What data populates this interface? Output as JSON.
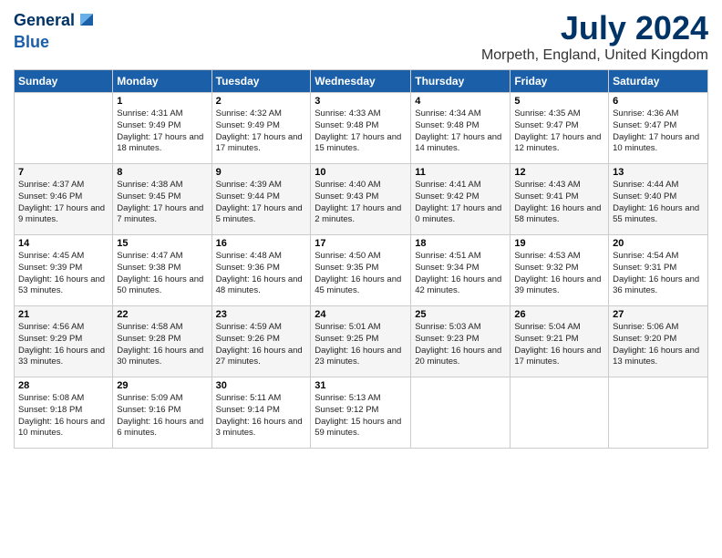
{
  "header": {
    "logo_line1": "General",
    "logo_line2": "Blue",
    "title": "July 2024",
    "subtitle": "Morpeth, England, United Kingdom"
  },
  "columns": [
    "Sunday",
    "Monday",
    "Tuesday",
    "Wednesday",
    "Thursday",
    "Friday",
    "Saturday"
  ],
  "weeks": [
    [
      {
        "date": "",
        "sunrise": "",
        "sunset": "",
        "daylight": ""
      },
      {
        "date": "1",
        "sunrise": "Sunrise: 4:31 AM",
        "sunset": "Sunset: 9:49 PM",
        "daylight": "Daylight: 17 hours and 18 minutes."
      },
      {
        "date": "2",
        "sunrise": "Sunrise: 4:32 AM",
        "sunset": "Sunset: 9:49 PM",
        "daylight": "Daylight: 17 hours and 17 minutes."
      },
      {
        "date": "3",
        "sunrise": "Sunrise: 4:33 AM",
        "sunset": "Sunset: 9:48 PM",
        "daylight": "Daylight: 17 hours and 15 minutes."
      },
      {
        "date": "4",
        "sunrise": "Sunrise: 4:34 AM",
        "sunset": "Sunset: 9:48 PM",
        "daylight": "Daylight: 17 hours and 14 minutes."
      },
      {
        "date": "5",
        "sunrise": "Sunrise: 4:35 AM",
        "sunset": "Sunset: 9:47 PM",
        "daylight": "Daylight: 17 hours and 12 minutes."
      },
      {
        "date": "6",
        "sunrise": "Sunrise: 4:36 AM",
        "sunset": "Sunset: 9:47 PM",
        "daylight": "Daylight: 17 hours and 10 minutes."
      }
    ],
    [
      {
        "date": "7",
        "sunrise": "Sunrise: 4:37 AM",
        "sunset": "Sunset: 9:46 PM",
        "daylight": "Daylight: 17 hours and 9 minutes."
      },
      {
        "date": "8",
        "sunrise": "Sunrise: 4:38 AM",
        "sunset": "Sunset: 9:45 PM",
        "daylight": "Daylight: 17 hours and 7 minutes."
      },
      {
        "date": "9",
        "sunrise": "Sunrise: 4:39 AM",
        "sunset": "Sunset: 9:44 PM",
        "daylight": "Daylight: 17 hours and 5 minutes."
      },
      {
        "date": "10",
        "sunrise": "Sunrise: 4:40 AM",
        "sunset": "Sunset: 9:43 PM",
        "daylight": "Daylight: 17 hours and 2 minutes."
      },
      {
        "date": "11",
        "sunrise": "Sunrise: 4:41 AM",
        "sunset": "Sunset: 9:42 PM",
        "daylight": "Daylight: 17 hours and 0 minutes."
      },
      {
        "date": "12",
        "sunrise": "Sunrise: 4:43 AM",
        "sunset": "Sunset: 9:41 PM",
        "daylight": "Daylight: 16 hours and 58 minutes."
      },
      {
        "date": "13",
        "sunrise": "Sunrise: 4:44 AM",
        "sunset": "Sunset: 9:40 PM",
        "daylight": "Daylight: 16 hours and 55 minutes."
      }
    ],
    [
      {
        "date": "14",
        "sunrise": "Sunrise: 4:45 AM",
        "sunset": "Sunset: 9:39 PM",
        "daylight": "Daylight: 16 hours and 53 minutes."
      },
      {
        "date": "15",
        "sunrise": "Sunrise: 4:47 AM",
        "sunset": "Sunset: 9:38 PM",
        "daylight": "Daylight: 16 hours and 50 minutes."
      },
      {
        "date": "16",
        "sunrise": "Sunrise: 4:48 AM",
        "sunset": "Sunset: 9:36 PM",
        "daylight": "Daylight: 16 hours and 48 minutes."
      },
      {
        "date": "17",
        "sunrise": "Sunrise: 4:50 AM",
        "sunset": "Sunset: 9:35 PM",
        "daylight": "Daylight: 16 hours and 45 minutes."
      },
      {
        "date": "18",
        "sunrise": "Sunrise: 4:51 AM",
        "sunset": "Sunset: 9:34 PM",
        "daylight": "Daylight: 16 hours and 42 minutes."
      },
      {
        "date": "19",
        "sunrise": "Sunrise: 4:53 AM",
        "sunset": "Sunset: 9:32 PM",
        "daylight": "Daylight: 16 hours and 39 minutes."
      },
      {
        "date": "20",
        "sunrise": "Sunrise: 4:54 AM",
        "sunset": "Sunset: 9:31 PM",
        "daylight": "Daylight: 16 hours and 36 minutes."
      }
    ],
    [
      {
        "date": "21",
        "sunrise": "Sunrise: 4:56 AM",
        "sunset": "Sunset: 9:29 PM",
        "daylight": "Daylight: 16 hours and 33 minutes."
      },
      {
        "date": "22",
        "sunrise": "Sunrise: 4:58 AM",
        "sunset": "Sunset: 9:28 PM",
        "daylight": "Daylight: 16 hours and 30 minutes."
      },
      {
        "date": "23",
        "sunrise": "Sunrise: 4:59 AM",
        "sunset": "Sunset: 9:26 PM",
        "daylight": "Daylight: 16 hours and 27 minutes."
      },
      {
        "date": "24",
        "sunrise": "Sunrise: 5:01 AM",
        "sunset": "Sunset: 9:25 PM",
        "daylight": "Daylight: 16 hours and 23 minutes."
      },
      {
        "date": "25",
        "sunrise": "Sunrise: 5:03 AM",
        "sunset": "Sunset: 9:23 PM",
        "daylight": "Daylight: 16 hours and 20 minutes."
      },
      {
        "date": "26",
        "sunrise": "Sunrise: 5:04 AM",
        "sunset": "Sunset: 9:21 PM",
        "daylight": "Daylight: 16 hours and 17 minutes."
      },
      {
        "date": "27",
        "sunrise": "Sunrise: 5:06 AM",
        "sunset": "Sunset: 9:20 PM",
        "daylight": "Daylight: 16 hours and 13 minutes."
      }
    ],
    [
      {
        "date": "28",
        "sunrise": "Sunrise: 5:08 AM",
        "sunset": "Sunset: 9:18 PM",
        "daylight": "Daylight: 16 hours and 10 minutes."
      },
      {
        "date": "29",
        "sunrise": "Sunrise: 5:09 AM",
        "sunset": "Sunset: 9:16 PM",
        "daylight": "Daylight: 16 hours and 6 minutes."
      },
      {
        "date": "30",
        "sunrise": "Sunrise: 5:11 AM",
        "sunset": "Sunset: 9:14 PM",
        "daylight": "Daylight: 16 hours and 3 minutes."
      },
      {
        "date": "31",
        "sunrise": "Sunrise: 5:13 AM",
        "sunset": "Sunset: 9:12 PM",
        "daylight": "Daylight: 15 hours and 59 minutes."
      },
      {
        "date": "",
        "sunrise": "",
        "sunset": "",
        "daylight": ""
      },
      {
        "date": "",
        "sunrise": "",
        "sunset": "",
        "daylight": ""
      },
      {
        "date": "",
        "sunrise": "",
        "sunset": "",
        "daylight": ""
      }
    ]
  ]
}
